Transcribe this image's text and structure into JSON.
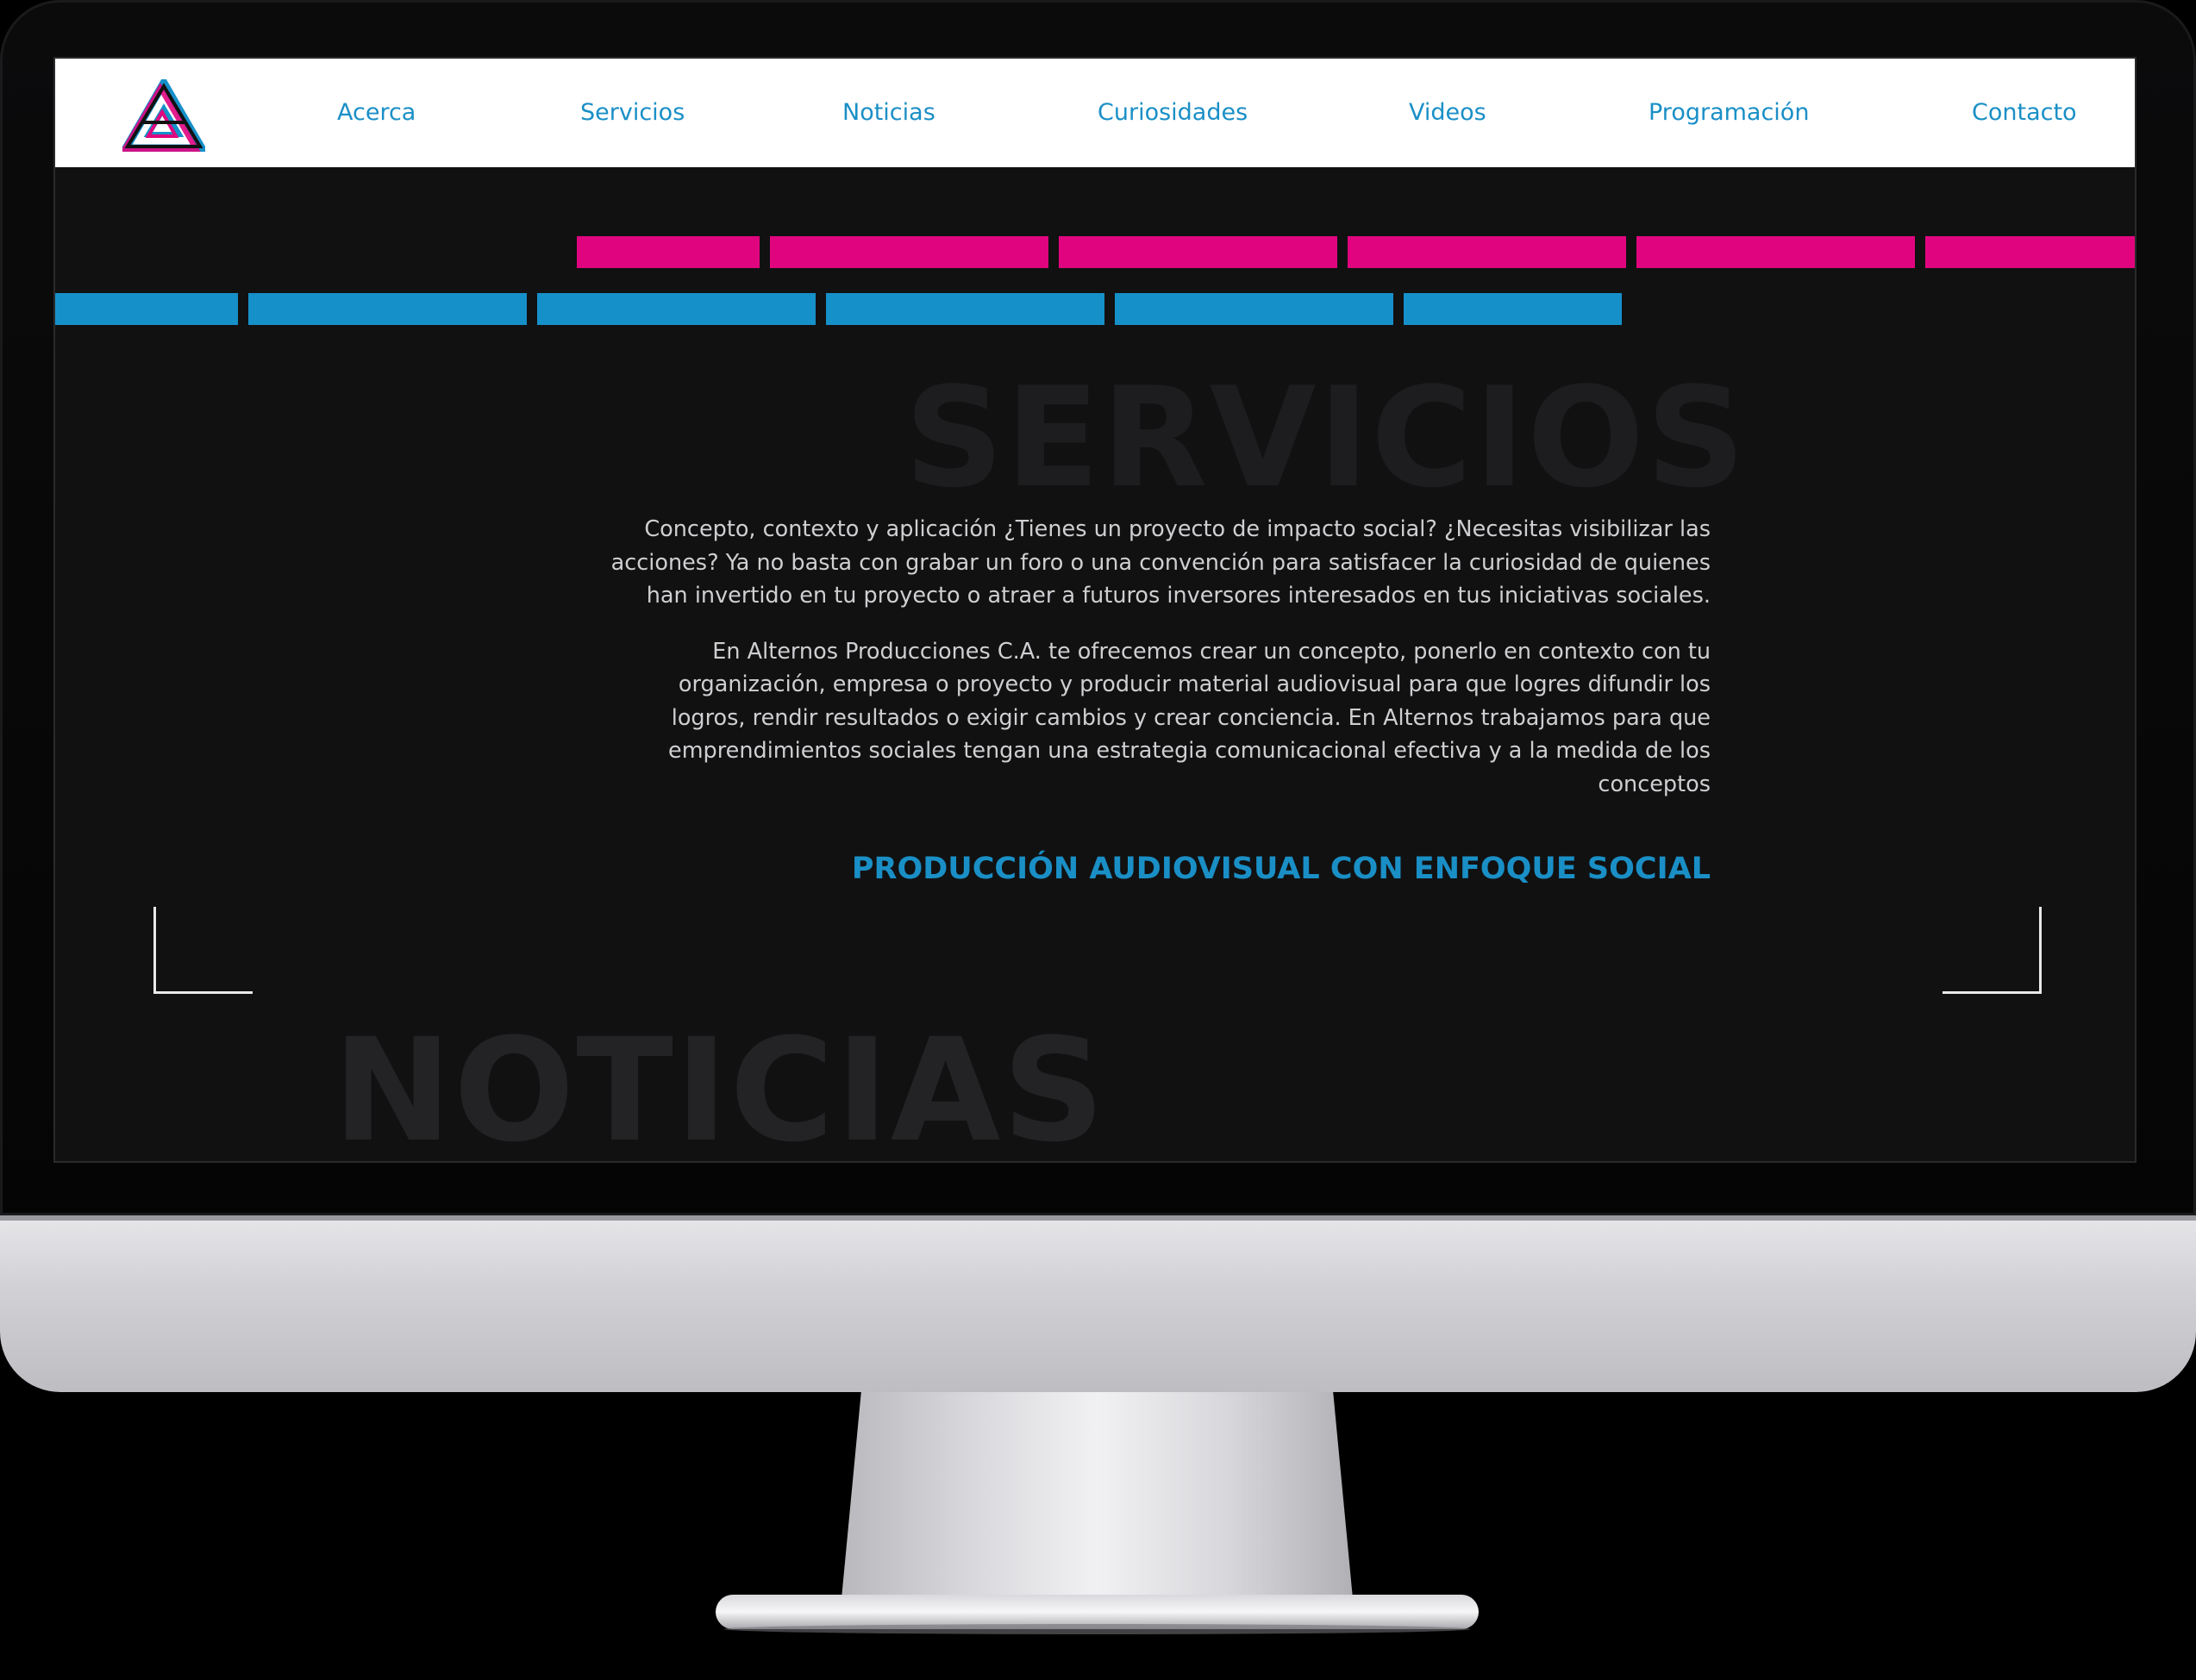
{
  "nav": {
    "logo_alt": "Alternos Producciones",
    "items": [
      {
        "label": "Acerca"
      },
      {
        "label": "Servicios"
      },
      {
        "label": "Noticias"
      },
      {
        "label": "Curiosidades"
      },
      {
        "label": "Videos"
      },
      {
        "label": "Programación"
      },
      {
        "label": "Contacto"
      }
    ]
  },
  "hero": {
    "watermark": "SERVICIOS",
    "paragraphs": [
      "Concepto, contexto y aplicación ¿Tienes un proyecto de impacto social? ¿Necesitas visibilizar las acciones? Ya no basta con grabar un foro o una convención para satisfacer la curiosidad de quienes han invertido en tu proyecto o atraer a futuros inversores interesados en tus iniciativas sociales.",
      "En Alternos Producciones C.A. te ofrecemos crear un concepto, ponerlo en contexto con tu organización, empresa o proyecto y producir material audiovisual para que logres difundir los logros, rendir resultados o exigir cambios y crear conciencia. En Alternos trabajamos para que emprendimientos sociales tengan una estrategia comunicacional efectiva y a la medida de los conceptos"
    ],
    "heading": "PRODUCCIÓN AUDIOVISUAL CON ENFOQUE SOCIAL"
  },
  "next_section": {
    "watermark": "NOTICIAS"
  },
  "colors": {
    "accent_blue": "#1a8fc6",
    "accent_pink": "#e0057f",
    "background": "#111112",
    "navbar": "#ffffff"
  },
  "icons": {
    "logo": "triangle-logo-icon",
    "corner_left": "corner-bracket-left-icon",
    "corner_right": "corner-bracket-right-icon"
  }
}
